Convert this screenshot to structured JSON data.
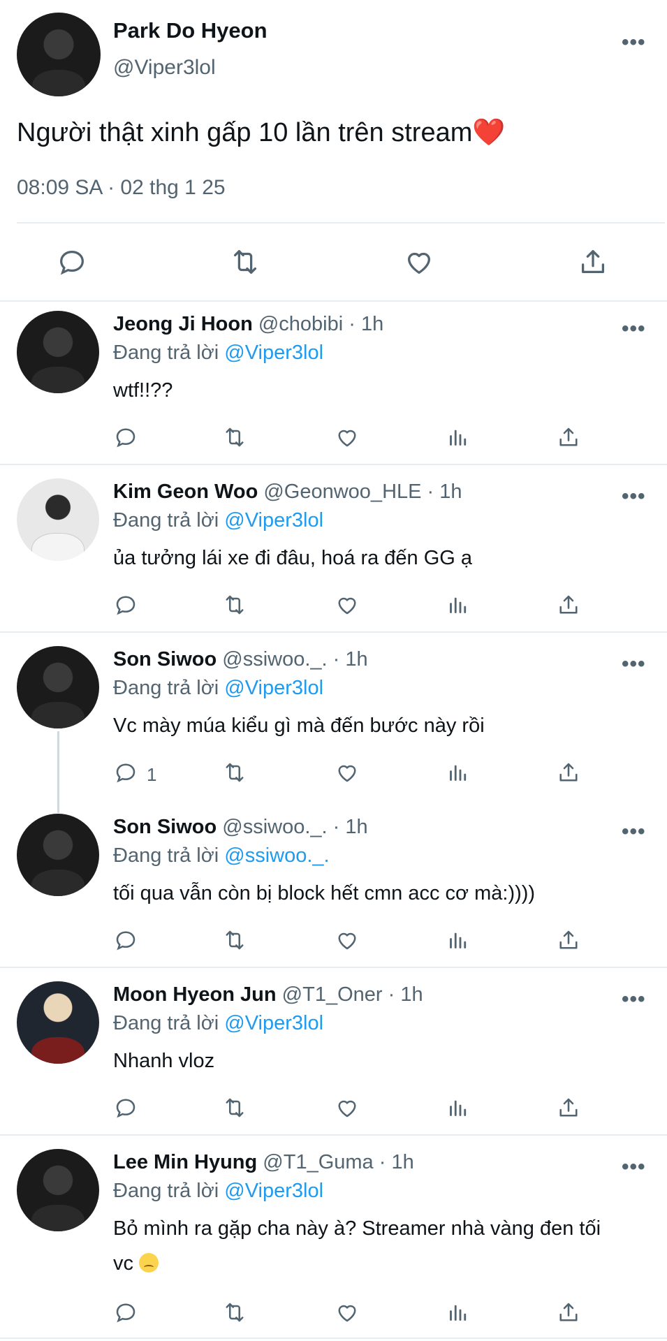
{
  "main_tweet": {
    "name": "Park Do Hyeon",
    "handle": "@Viper3lol",
    "text": "Người thật xinh gấp 10 lần trên stream",
    "text_emoji": "❤️",
    "meta": "08:09 SA · 02 thg 1 25",
    "actions": [
      "reply-icon",
      "retweet-icon",
      "like-icon",
      "share-icon"
    ]
  },
  "more_label": "•••",
  "replying_prefix": "Đang trả lời",
  "replies": [
    {
      "name": "Jeong Ji Hoon",
      "rest": " @chobibi · 1h",
      "replying_to": "@Viper3lol",
      "text": "wtf!!??",
      "reply_count": ""
    },
    {
      "name": "Kim Geon Woo",
      "rest": " @Geonwoo_HLE · 1h",
      "replying_to": "@Viper3lol",
      "text": "ủa tưởng lái xe đi đâu, hoá ra đến GG ạ",
      "reply_count": ""
    },
    {
      "name": "Son Siwoo",
      "rest": " @ssiwoo._. · 1h",
      "replying_to": "@Viper3lol",
      "text": "Vc mày múa kiểu gì mà đến bước này rồi",
      "reply_count": "1"
    },
    {
      "name": "Son Siwoo",
      "rest": " @ssiwoo._. · 1h",
      "replying_to": "@ssiwoo._.",
      "text": "tối qua vẫn còn bị block hết cmn acc cơ mà:))))",
      "reply_count": ""
    },
    {
      "name": "Moon Hyeon Jun",
      "rest": " @T1_Oner · 1h",
      "replying_to": "@Viper3lol",
      "text": "Nhanh vloz",
      "reply_count": ""
    },
    {
      "name": "Lee Min Hyung",
      "rest": " @T1_Guma · 1h",
      "replying_to": "@Viper3lol",
      "text": "Bỏ mình ra gặp cha này à? Streamer nhà vàng đen tối vc",
      "text_emoji": "😢",
      "reply_count": ""
    }
  ],
  "reply_actions": [
    "reply-icon",
    "retweet-icon",
    "like-icon",
    "views-icon",
    "share-icon"
  ],
  "colors": {
    "link": "#1d9bf0",
    "secondary": "#536471",
    "divider": "#e6ecf0"
  }
}
